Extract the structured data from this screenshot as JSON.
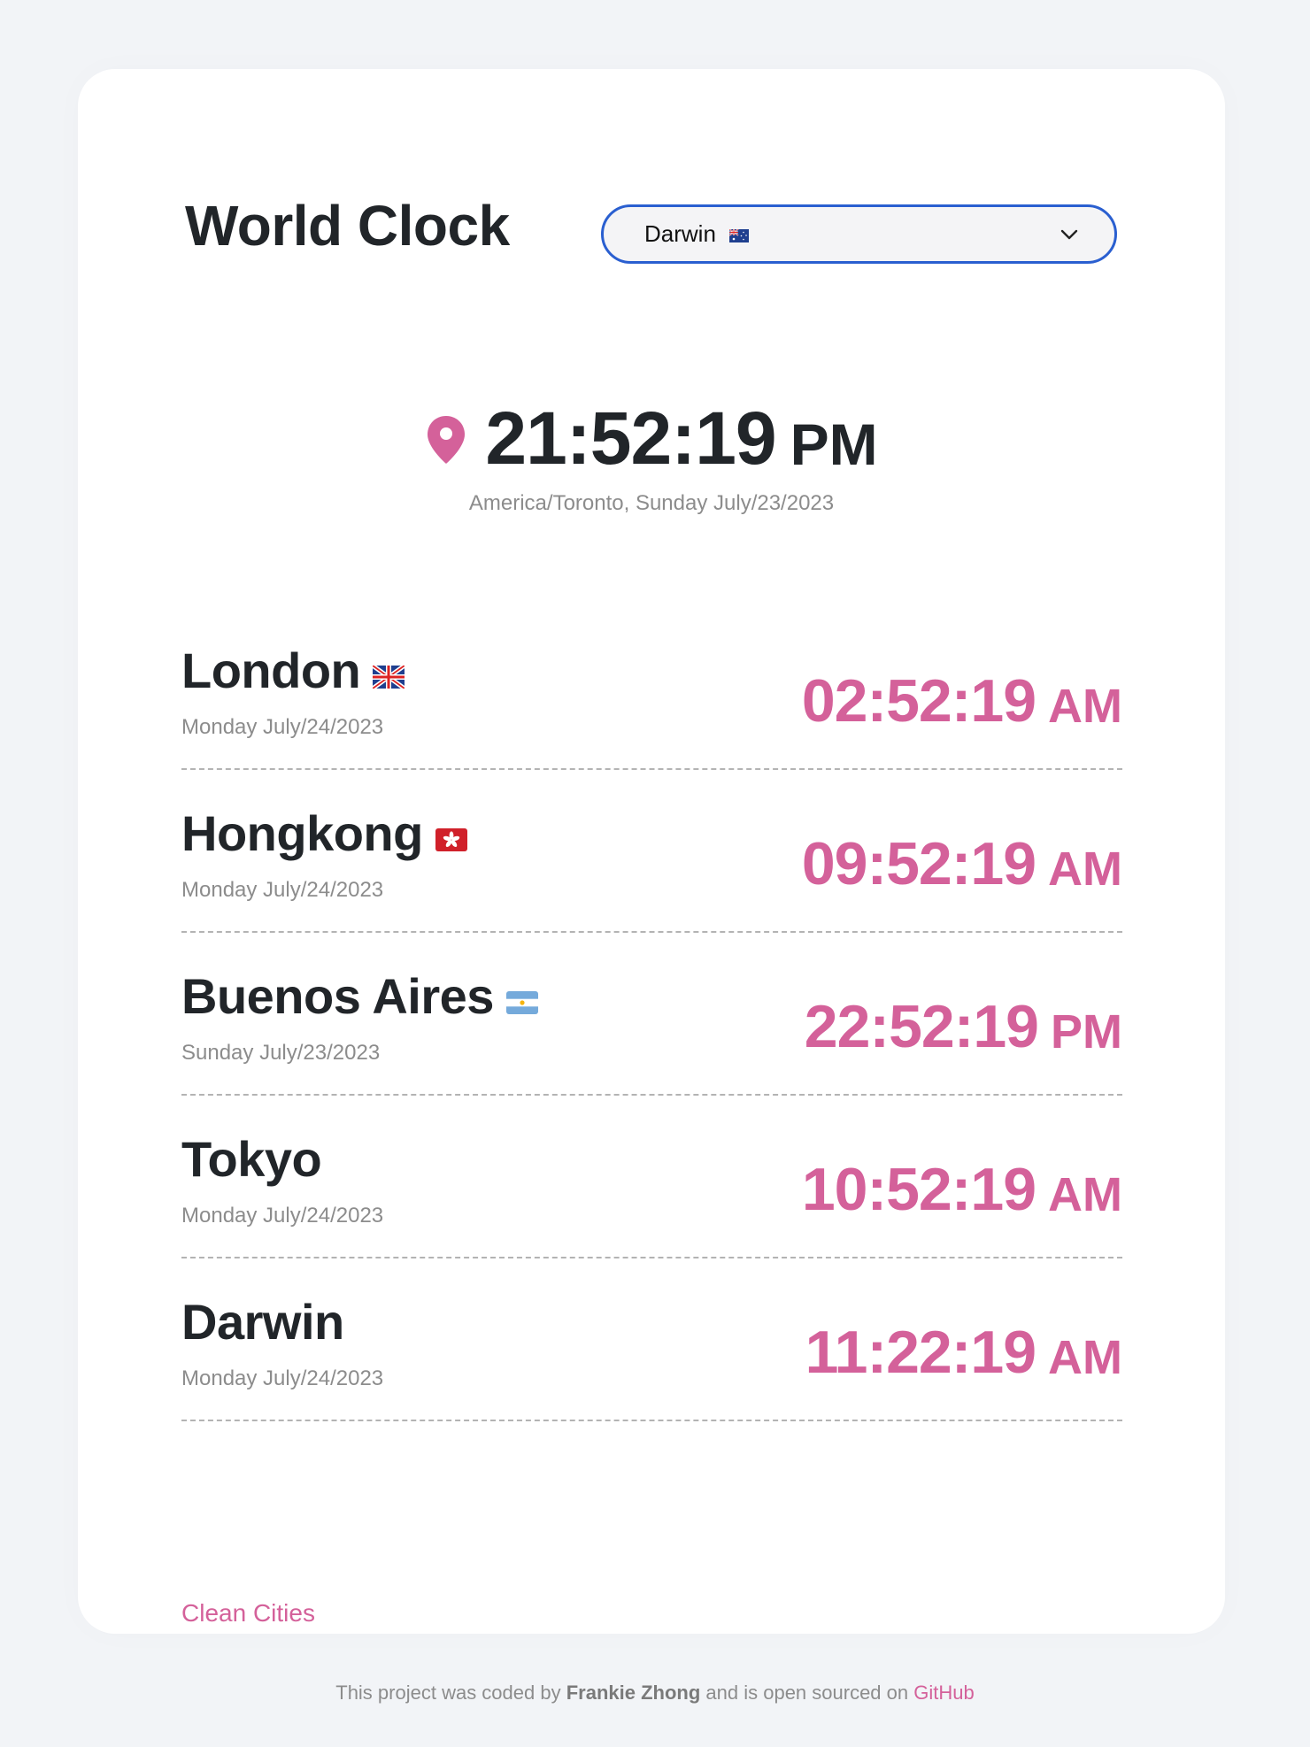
{
  "app": {
    "title": "World Clock"
  },
  "selector": {
    "selected_label": "Darwin",
    "selected_flag": "flag-au-icon"
  },
  "current": {
    "time": "21:52:19",
    "ampm": "PM",
    "timezone_date": "America/Toronto, Sunday July/23/2023",
    "icon": "location-pin-icon"
  },
  "cities": [
    {
      "name": "London",
      "flag": "flag-uk-icon",
      "date": "Monday July/24/2023",
      "time": "02:52:19",
      "ampm": "AM"
    },
    {
      "name": "Hongkong",
      "flag": "flag-hk-icon",
      "date": "Monday July/24/2023",
      "time": "09:52:19",
      "ampm": "AM"
    },
    {
      "name": "Buenos Aires",
      "flag": "flag-ar-icon",
      "date": "Sunday July/23/2023",
      "time": "22:52:19",
      "ampm": "PM"
    },
    {
      "name": "Tokyo",
      "flag": "",
      "date": "Monday July/24/2023",
      "time": "10:52:19",
      "ampm": "AM"
    },
    {
      "name": "Darwin",
      "flag": "",
      "date": "Monday July/24/2023",
      "time": "11:22:19",
      "ampm": "AM"
    }
  ],
  "actions": {
    "clean_label": "Clean Cities"
  },
  "footer": {
    "prefix": "This project was coded by",
    "author": "Frankie Zhong",
    "middle": "and is open sourced on",
    "link_label": "GitHub"
  },
  "colors": {
    "accent": "#d4619a",
    "text": "#212529",
    "muted": "#8c8c8c",
    "select_border": "#2a5fd0",
    "background": "#f2f4f7"
  }
}
